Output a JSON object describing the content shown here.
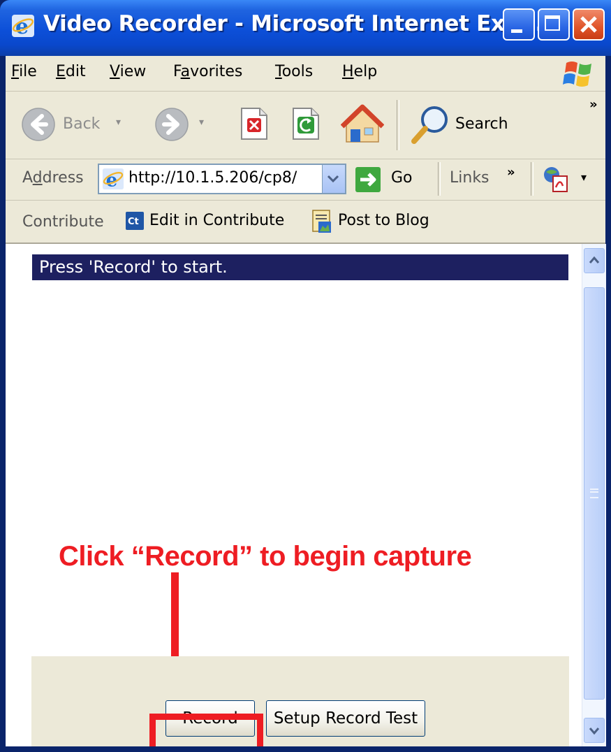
{
  "window": {
    "title": "Video Recorder - Microsoft Internet Expl..."
  },
  "menu": {
    "items": [
      {
        "label": "File",
        "accel_index": 0
      },
      {
        "label": "Edit",
        "accel_index": 0
      },
      {
        "label": "View",
        "accel_index": 0
      },
      {
        "label": "Favorites",
        "accel_index": 1
      },
      {
        "label": "Tools",
        "accel_index": 0
      },
      {
        "label": "Help",
        "accel_index": 0
      }
    ]
  },
  "toolbar": {
    "back_label": "Back",
    "search_label": "Search",
    "overflow": "»"
  },
  "address": {
    "label": "Address",
    "url": "http://10.1.5.206/cp8/",
    "go_label": "Go",
    "links_label": "Links",
    "links_overflow": "»"
  },
  "contribute": {
    "label": "Contribute",
    "edit_label": "Edit in Contribute",
    "post_label": "Post to Blog"
  },
  "page": {
    "status_text": "Press 'Record' to start.",
    "annotation": "Click “Record” to begin capture",
    "record_button": "Record",
    "setup_button": "Setup Record Test"
  },
  "colors": {
    "annotation_red": "#ee1d23",
    "status_bg": "#1d2060",
    "xp_titlebar_blue": "#0c4fd8",
    "chrome_bg": "#ece9d8"
  },
  "icons": {
    "title": "ie-icon",
    "back": "back-arrow-icon",
    "forward": "forward-arrow-icon",
    "stop": "stop-icon",
    "refresh": "refresh-icon",
    "home": "home-icon",
    "search": "search-icon",
    "go": "go-arrow-icon",
    "windows_logo": "windows-logo-icon"
  }
}
